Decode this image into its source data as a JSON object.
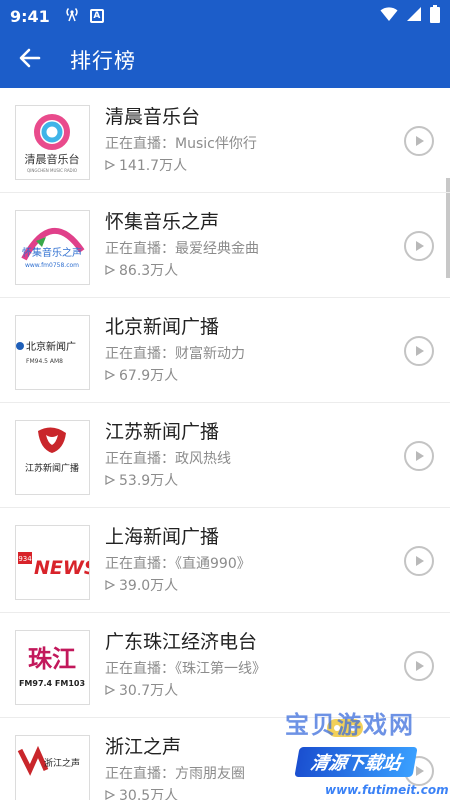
{
  "status_bar": {
    "time": "9:41",
    "app_badge": "A",
    "icons": [
      "hotspot-icon",
      "wifi-icon",
      "cell-signal-icon",
      "battery-icon"
    ]
  },
  "toolbar": {
    "back_icon": "arrow-left-icon",
    "title": "排行榜"
  },
  "colors": {
    "primary": "#1c5dc9",
    "text_primary": "#222222",
    "text_secondary": "#8c8c8c",
    "play_icon": "#c4c4c4"
  },
  "stations": [
    {
      "name": "清晨音乐台",
      "desc": "正在直播：Music伴你行",
      "listeners": "141.7万人",
      "logo_text": "清晨音乐台",
      "logo_sub": "QINGCHEN MUSIC RADIO"
    },
    {
      "name": "怀集音乐之声",
      "desc": "正在直播：最爱经典金曲",
      "listeners": "86.3万人",
      "logo_text": "怀集音乐之声",
      "logo_sub": "www.fm0758.com"
    },
    {
      "name": "北京新闻广播",
      "desc": "正在直播：财富新动力",
      "listeners": "67.9万人",
      "logo_text": "北京新闻广",
      "logo_sub": "FM94.5   AM8"
    },
    {
      "name": "江苏新闻广播",
      "desc": "正在直播：政风热线",
      "listeners": "53.9万人",
      "logo_text": "江苏新闻广播",
      "logo_sub": ""
    },
    {
      "name": "上海新闻广播",
      "desc": "正在直播：《直通990》",
      "listeners": "39.0万人",
      "logo_text": "NEWS",
      "logo_sub": "934"
    },
    {
      "name": "广东珠江经济电台",
      "desc": "正在直播：《珠江第一线》",
      "listeners": "30.7万人",
      "logo_text": "珠江",
      "logo_sub": "FM97.4 FM103"
    },
    {
      "name": "浙江之声",
      "desc": "正在直播：方雨朋友圈",
      "listeners": "30.5万人",
      "logo_text": "浙江之声",
      "logo_sub": ""
    }
  ],
  "watermark": {
    "line1": "宝贝游戏网",
    "banner": "清源下载站",
    "url": "www.futimeit.com"
  }
}
